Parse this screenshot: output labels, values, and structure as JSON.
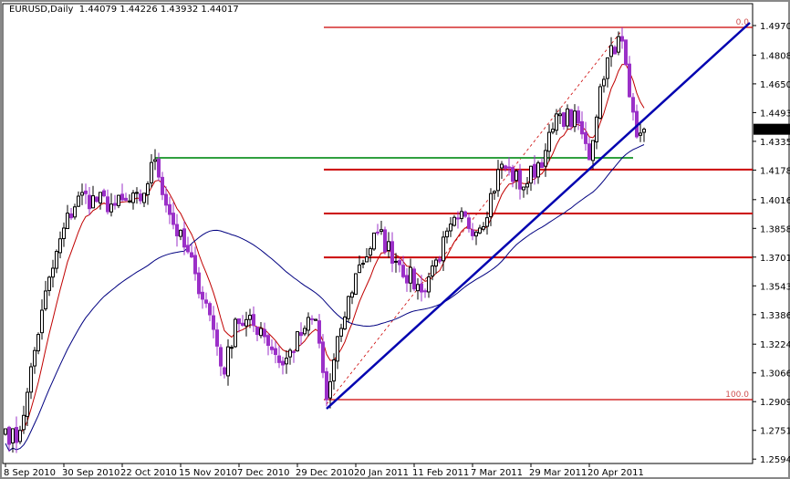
{
  "header": {
    "symbol": "EURUSD,Daily",
    "ohlc": "1.44079 1.44226 1.43932 1.44017"
  },
  "chart_data": {
    "type": "candlestick",
    "symbol": "EURUSD",
    "timeframe": "Daily",
    "last_price": "1.44017",
    "ylim": [
      1.2594,
      1.497
    ],
    "y_ticks": [
      "1.49700",
      "1.48080",
      "1.46505",
      "1.44930",
      "1.43355",
      "1.41780",
      "1.40160",
      "1.38585",
      "1.37010",
      "1.35435",
      "1.33860",
      "1.32240",
      "1.30665",
      "1.29090",
      "1.27515",
      "1.25940"
    ],
    "x_ticks": [
      "8 Sep 2010",
      "30 Sep 2010",
      "22 Oct 2010",
      "15 Nov 2010",
      "7 Dec 2010",
      "29 Dec 2010",
      "20 Jan 2011",
      "11 Feb 2011",
      "7 Mar 2011",
      "29 Mar 2011",
      "20 Apr 2011"
    ],
    "bars_total": 176,
    "close_path": [
      [
        0,
        1.276
      ],
      [
        3,
        1.2685
      ],
      [
        6,
        1.296
      ],
      [
        10,
        1.341
      ],
      [
        16,
        1.386
      ],
      [
        20,
        1.4035
      ],
      [
        30,
        1.3985
      ],
      [
        37,
        1.401
      ],
      [
        41,
        1.4235
      ],
      [
        45,
        1.3935
      ],
      [
        52,
        1.361
      ],
      [
        56,
        1.3385
      ],
      [
        60,
        1.306
      ],
      [
        63,
        1.336
      ],
      [
        70,
        1.331
      ],
      [
        76,
        1.311
      ],
      [
        82,
        1.331
      ],
      [
        85,
        1.336
      ],
      [
        88,
        1.292
      ],
      [
        92,
        1.331
      ],
      [
        96,
        1.361
      ],
      [
        102,
        1.3835
      ],
      [
        108,
        1.366
      ],
      [
        114,
        1.351
      ],
      [
        118,
        1.3685
      ],
      [
        124,
        1.391
      ],
      [
        130,
        1.386
      ],
      [
        136,
        1.421
      ],
      [
        142,
        1.4085
      ],
      [
        148,
        1.4285
      ],
      [
        152,
        1.4485
      ],
      [
        157,
        1.4435
      ],
      [
        160,
        1.4235
      ],
      [
        163,
        1.4635
      ],
      [
        166,
        1.486
      ],
      [
        169,
        1.4885
      ],
      [
        171,
        1.458
      ],
      [
        173,
        1.436
      ],
      [
        175,
        1.44017
      ]
    ],
    "fibonacci": {
      "high": 1.496,
      "low": 1.292,
      "levels": [
        {
          "label": "0.0",
          "ratio": 0
        },
        {
          "ratio": 0.382
        },
        {
          "ratio": 0.5
        },
        {
          "ratio": 0.618
        },
        {
          "label": "100.0",
          "ratio": 1
        }
      ]
    },
    "horizontal_line": 1.4245,
    "trendline": {
      "from": [
        88,
        1.287
      ],
      "to": [
        204,
        1.4985
      ]
    },
    "fib_trend_dashed": {
      "from": [
        88,
        1.2895
      ],
      "to": [
        169,
        1.4945
      ]
    },
    "moving_averages": [
      {
        "name": "fast",
        "period": 8,
        "color": "#c00000"
      },
      {
        "name": "slow",
        "period": 50,
        "color": "#000080"
      }
    ],
    "colors": {
      "bull": "#ffffff",
      "bear": "#9b30c8",
      "outline": "#000000",
      "fib": "#cc0000",
      "hline": "#30a040",
      "trend": "#0000b0"
    }
  }
}
